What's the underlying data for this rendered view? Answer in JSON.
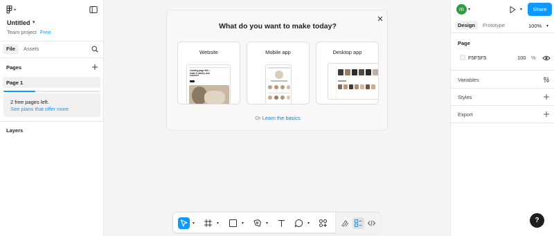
{
  "file": {
    "title": "Untitled",
    "project": "Team project",
    "plan": "Free"
  },
  "left_panel": {
    "tabs": [
      "File",
      "Assets"
    ],
    "pages_header": "Pages",
    "pages": [
      "Page 1"
    ],
    "free_pages_used_fraction": 0.33,
    "plan_notice": "2 free pages left.",
    "plan_link": "See plans that offer more",
    "layers_header": "Layers"
  },
  "right_panel": {
    "avatar_initial": "m",
    "share_label": "Share",
    "tabs": [
      "Design",
      "Prototype"
    ],
    "zoom": "100%",
    "page_section": "Page",
    "page_color": "F5F5F5",
    "page_opacity": "100",
    "opacity_unit": "%",
    "variables": "Variables",
    "styles": "Styles",
    "export": "Export"
  },
  "modal": {
    "title": "What do you want to make today?",
    "options": [
      "Website",
      "Mobile app",
      "Desktop app"
    ],
    "website_thumb_text": "Landing page title – make it catchy and succinct",
    "footer_prefix": "Or",
    "footer_link": "Learn the basics"
  },
  "help_label": "?",
  "colors": {
    "accent": "#0d99ff",
    "avatar": "#2c9c3f",
    "canvas": "#F5F5F5"
  }
}
